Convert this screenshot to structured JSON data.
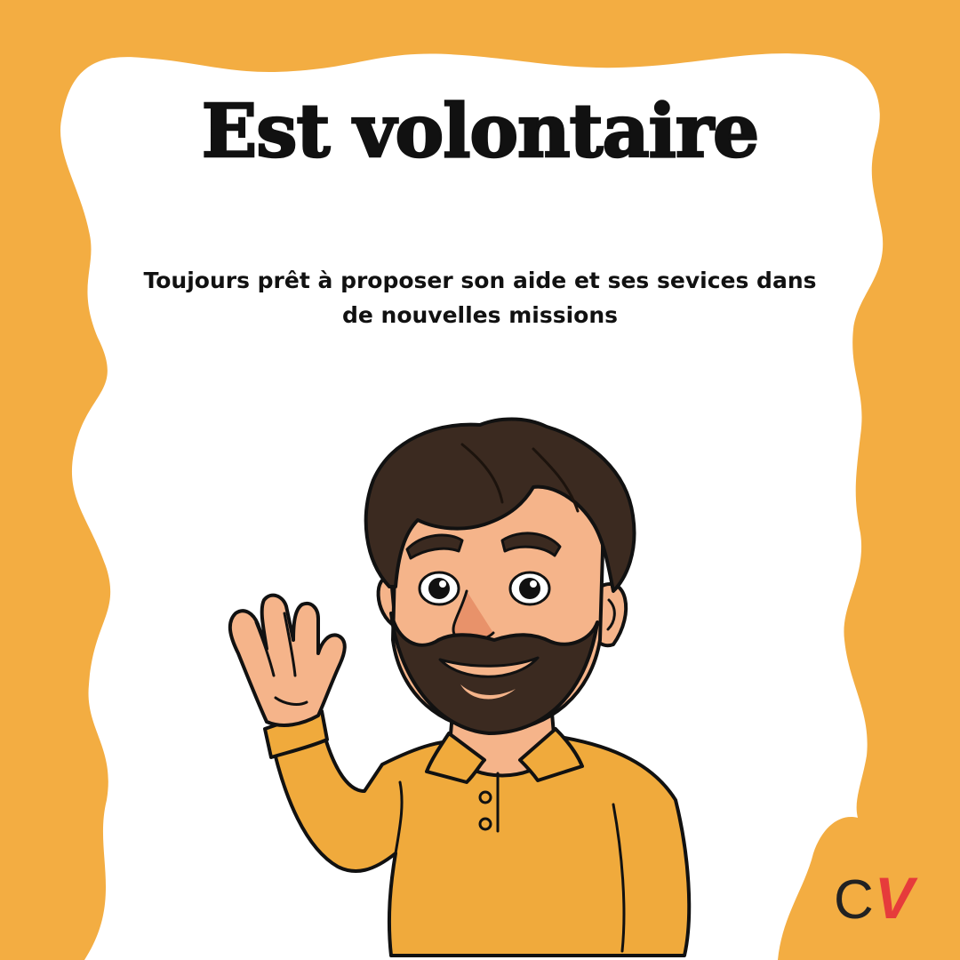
{
  "header": {
    "title": "Est volontaire",
    "subtitle": "Toujours prêt à proposer son aide et ses sevices dans de nouvelles missions"
  },
  "illustration": {
    "icon": "waving-bearded-man-illustration"
  },
  "logo": {
    "text": "CV",
    "letter_c": "C",
    "letter_v": "V"
  },
  "colors": {
    "background": "#f3ad42",
    "panel": "#ffffff",
    "text": "#111111",
    "logo_c": "#222222",
    "logo_v": "#e63b3b"
  }
}
